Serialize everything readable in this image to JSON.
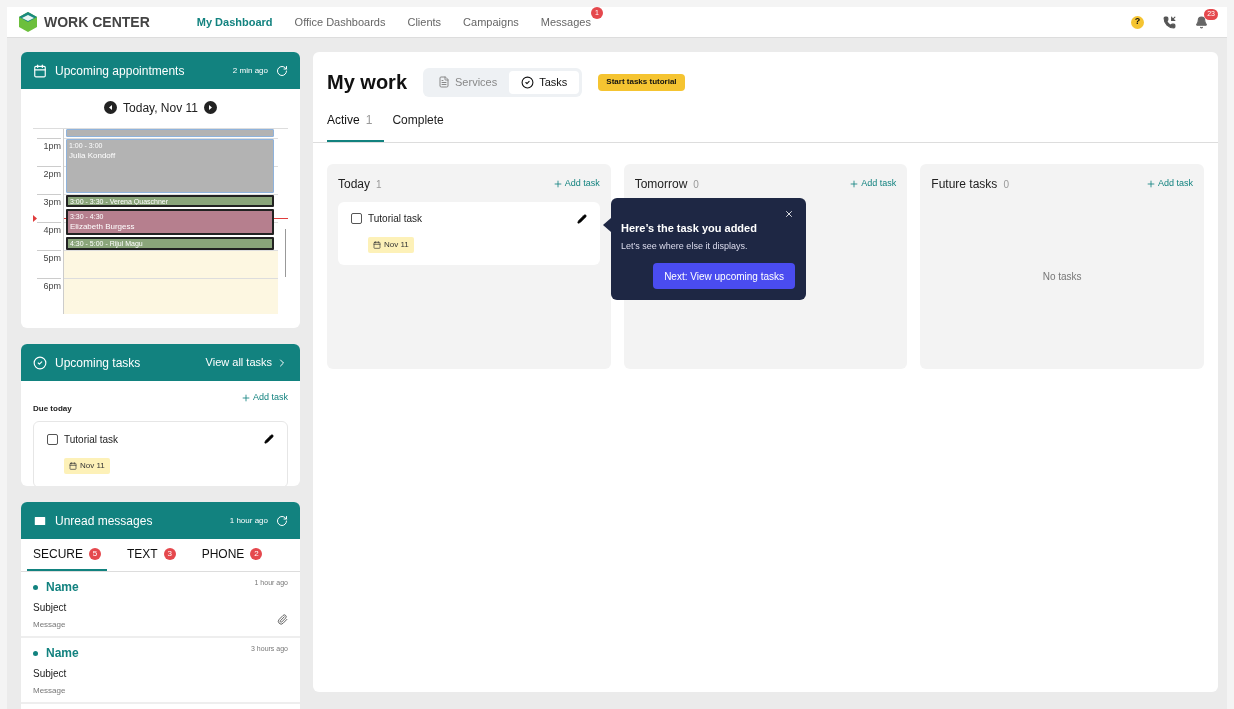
{
  "nav": {
    "brand": "WORK CENTER",
    "items": [
      {
        "label": "My Dashboard",
        "selected": true
      },
      {
        "label": "Office Dashboards",
        "selected": false
      },
      {
        "label": "Clients",
        "selected": false
      },
      {
        "label": "Campaigns",
        "selected": false
      },
      {
        "label": "Messages",
        "selected": false,
        "badge": "1"
      }
    ],
    "help": "?",
    "notifications_badge": "23"
  },
  "appointments": {
    "title": "Upcoming appointments",
    "updated": "2 min ago",
    "date": "Today, Nov 11",
    "hours": [
      "1pm",
      "2pm",
      "3pm",
      "4pm",
      "5pm",
      "6pm"
    ],
    "events": [
      {
        "kind": "blocked"
      },
      {
        "kind": "blocked",
        "time": "1:00 - 3:00",
        "name": "Julia Kondoff"
      },
      {
        "kind": "confirmed",
        "label": "3:00 - 3:30 - Verena Quaschner"
      },
      {
        "kind": "pending",
        "time": "3:30 - 4:30",
        "name": "Elizabeth Burgess"
      },
      {
        "kind": "confirmed",
        "label": "4:30 - 5:00 - Rijul Magu"
      }
    ]
  },
  "upcoming_tasks": {
    "title": "Upcoming tasks",
    "link": "View all tasks",
    "add": "Add task",
    "group": "Due today",
    "tasks": [
      {
        "title": "Tutorial task",
        "checked": false,
        "due": "Nov 11"
      }
    ]
  },
  "messages": {
    "title": "Unread messages",
    "updated": "1 hour ago",
    "tabs": [
      {
        "label": "SECURE",
        "count": "5",
        "selected": true
      },
      {
        "label": "TEXT",
        "count": "3",
        "selected": false
      },
      {
        "label": "PHONE",
        "count": "2",
        "selected": false
      }
    ],
    "items": [
      {
        "name": "Name",
        "subject": "Subject",
        "message": "Message",
        "time": "1 hour ago",
        "unread": true,
        "attachment": true
      },
      {
        "name": "Name",
        "subject": "Subject",
        "message": "Message",
        "time": "3 hours ago",
        "unread": true,
        "attachment": false
      }
    ]
  },
  "main": {
    "title": "My work",
    "views": [
      {
        "label": "Services",
        "kind": "document",
        "selected": false
      },
      {
        "label": "Tasks",
        "kind": "check",
        "selected": true
      }
    ],
    "tutorial_button": "Start tasks tutorial",
    "tabs": [
      {
        "label": "Active",
        "count": "1",
        "selected": true
      },
      {
        "label": "Complete",
        "selected": false
      }
    ],
    "columns": [
      {
        "title": "Today",
        "count": "1",
        "add": "Add task",
        "tasks": [
          {
            "title": "Tutorial task",
            "checked": false,
            "due": "Nov 11"
          }
        ]
      },
      {
        "title": "Tomorrow",
        "count": "0",
        "add": "Add task"
      },
      {
        "title": "Future tasks",
        "count": "0",
        "add": "Add task",
        "empty": "No tasks"
      }
    ],
    "popover": {
      "title": "Here’s the task you added",
      "text": "Let’s see where else it displays.",
      "button": "Next: View upcoming tasks"
    }
  }
}
